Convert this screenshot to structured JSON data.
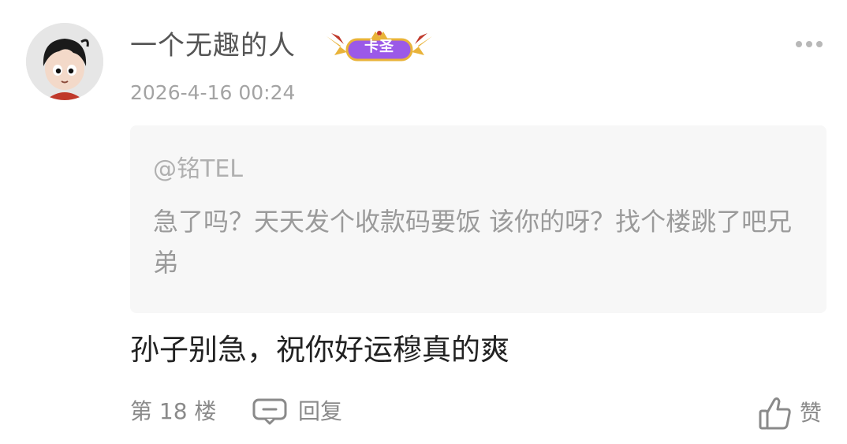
{
  "post": {
    "username": "一个无趣的人",
    "badge_label": "卡圣",
    "timestamp": "2026-4-16 00:24",
    "quote": {
      "author": "@铭TEL",
      "text": "急了吗？天天发个收款码要饭 该你的呀？找个楼跳了吧兄弟"
    },
    "content": "孙子别急，祝你好运穆真的爽"
  },
  "footer": {
    "floor": "第 18 楼",
    "reply_label": "回复",
    "like_label": "赞"
  },
  "icons": {
    "more": "more-horizontal-icon",
    "reply": "comment-bubble-icon",
    "like": "thumbs-up-icon"
  },
  "colors": {
    "quote_bg": "#f7f7f7",
    "badge_purple": "#9b59e8",
    "badge_gold": "#e9b339"
  }
}
